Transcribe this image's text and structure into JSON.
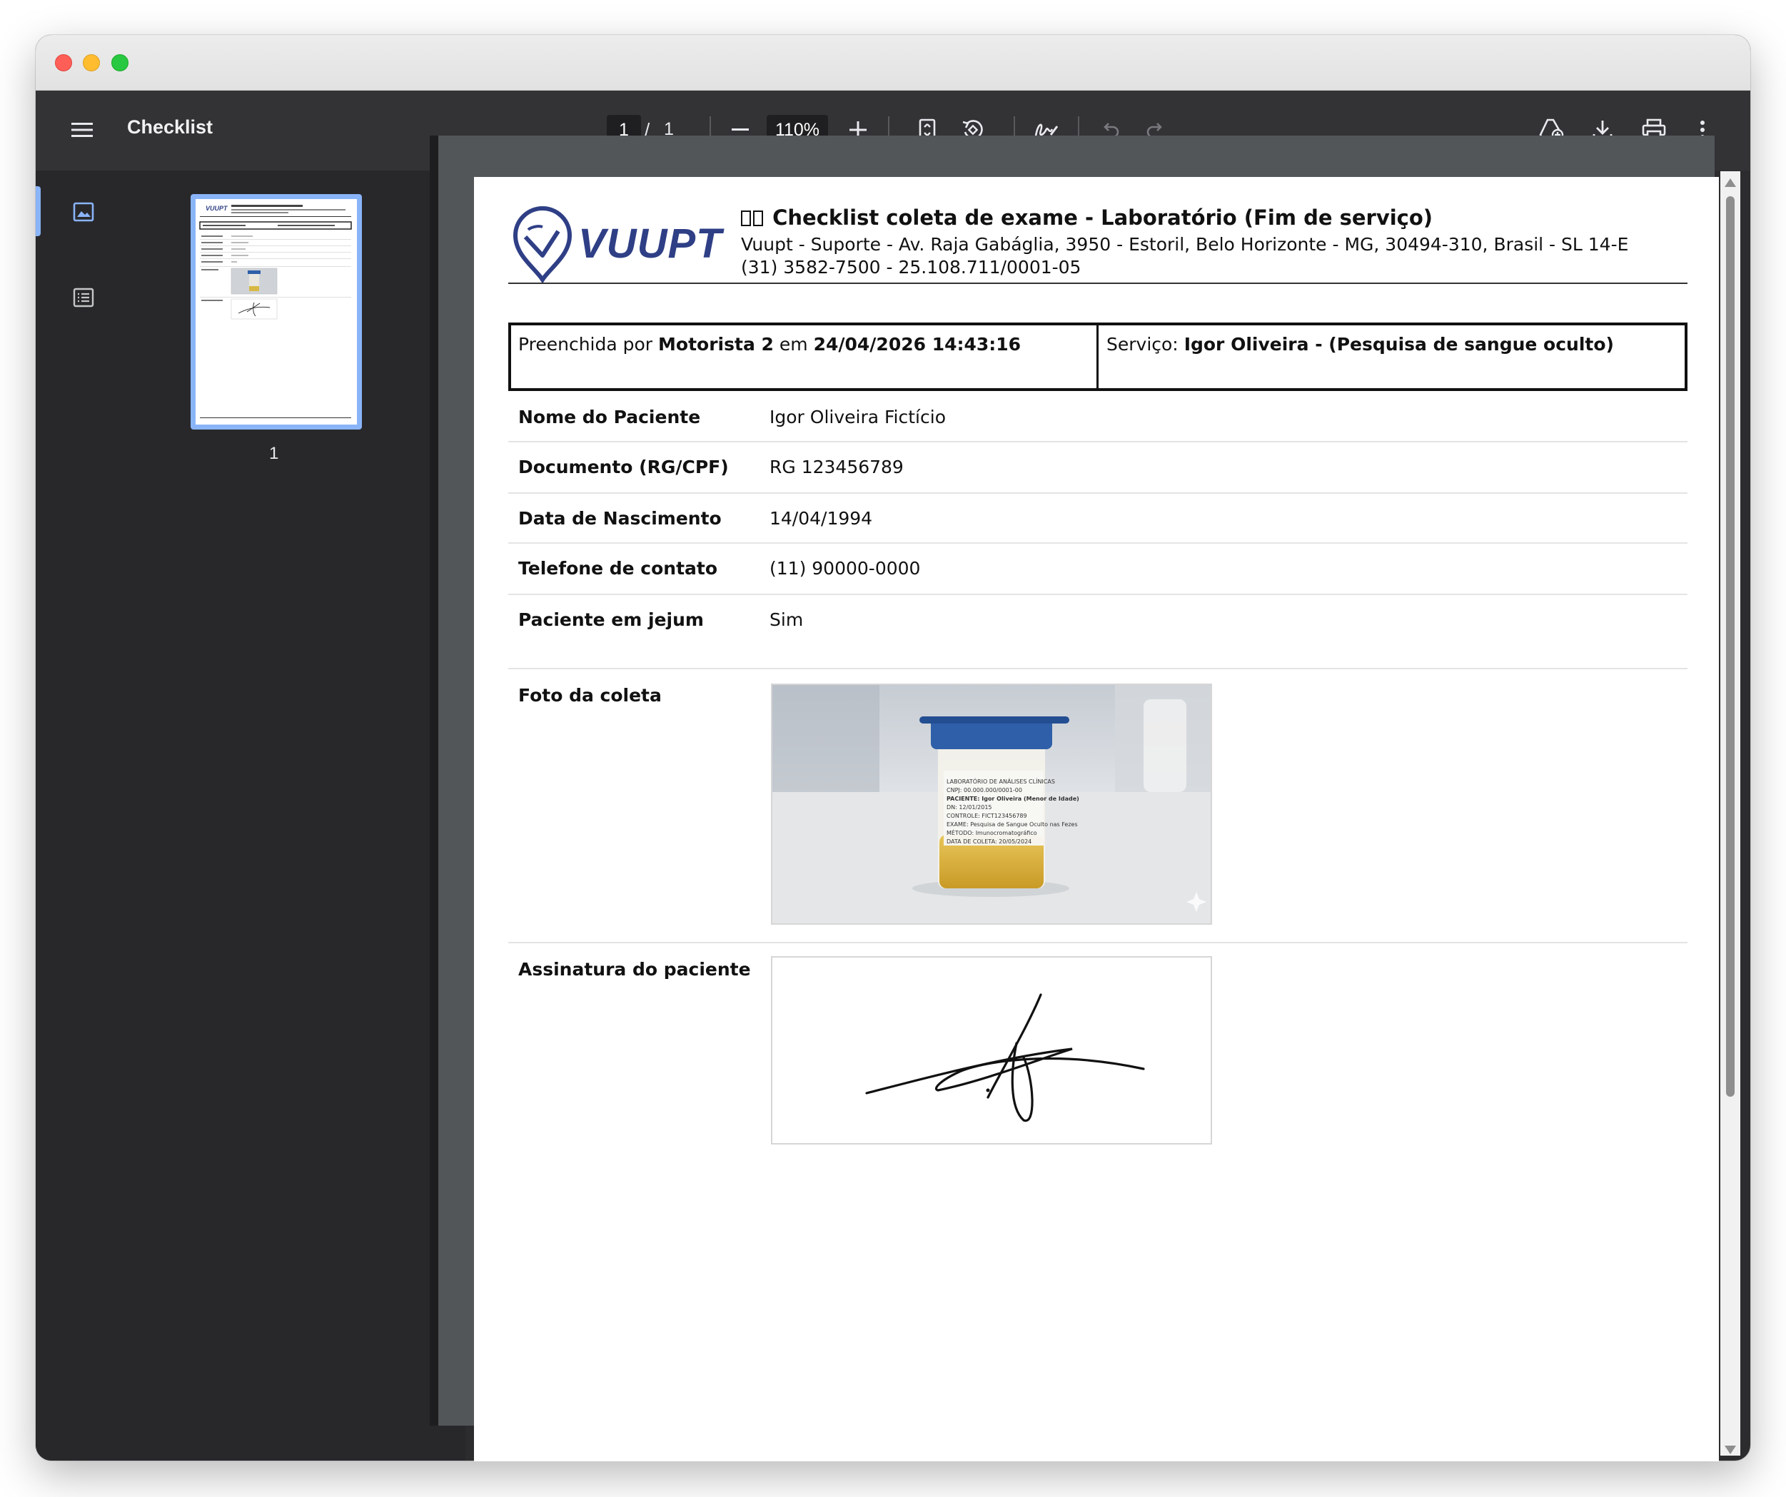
{
  "window": {
    "controls": [
      "close",
      "minimize",
      "zoom"
    ]
  },
  "toolbar": {
    "menu_icon": "hamburger-menu-icon",
    "title": "Checklist",
    "page_current": "1",
    "page_separator": "/",
    "page_total": "1",
    "zoom_out_icon": "minus-icon",
    "zoom_value": "110%",
    "zoom_in_icon": "plus-icon",
    "fit_page_icon": "fit-to-page-icon",
    "rotate_icon": "rotate-icon",
    "annotate_icon": "draw-signature-icon",
    "undo_icon": "undo-icon",
    "redo_icon": "redo-icon",
    "save_to_drive_icon": "drive-save-icon",
    "download_icon": "download-icon",
    "print_icon": "print-icon",
    "more_icon": "more-vertical-icon"
  },
  "sidebar": {
    "thumbnails_icon": "image-thumbnail-icon",
    "outline_icon": "document-outline-icon",
    "pages": [
      {
        "number": "1"
      }
    ]
  },
  "document": {
    "logo_text": "VUUPT",
    "title": "Checklist coleta de exame - Laboratório (Fim de serviço)",
    "address": "Vuupt - Suporte - Av. Raja Gabáglia, 3950 - Estoril, Belo Horizonte - MG, 30494-310, Brasil - SL 14-E",
    "contact": "(31) 3582-7500 - 25.108.711/0001-05",
    "filled_prefix": "Preenchida por",
    "filled_by": "Motorista 2",
    "filled_mid": "em",
    "filled_date": "24/04/2026 14:43:16",
    "service_prefix": "Serviço:",
    "service_name": "Igor Oliveira - (Pesquisa de sangue oculto)",
    "fields": [
      {
        "label": "Nome do Paciente",
        "value": "Igor Oliveira Fictício"
      },
      {
        "label": "Documento (RG/CPF)",
        "value": "RG 123456789"
      },
      {
        "label": "Data de Nascimento",
        "value": "14/04/1994"
      },
      {
        "label": "Telefone de contato",
        "value": "(11) 90000-0000"
      },
      {
        "label": "Paciente em jejum",
        "value": "Sim"
      }
    ],
    "photo_label": "Foto da coleta",
    "signature_label": "Assinatura do paciente",
    "photo_jar_label_lines": [
      "LABORATÓRIO DE ANÁLISES CLÍNICAS",
      "CNPJ: 00.000.000/0001-00",
      "PACIENTE: Igor Oliveira (Menor de Idade)",
      "DN: 12/01/2015",
      "CONTROLE: FICT123456789",
      "EXAME: Pesquisa de Sangue Oculto nas Fezes",
      "MÉTODO: Imunocromatográfico",
      "DATA DE COLETA: 20/05/2024"
    ]
  }
}
